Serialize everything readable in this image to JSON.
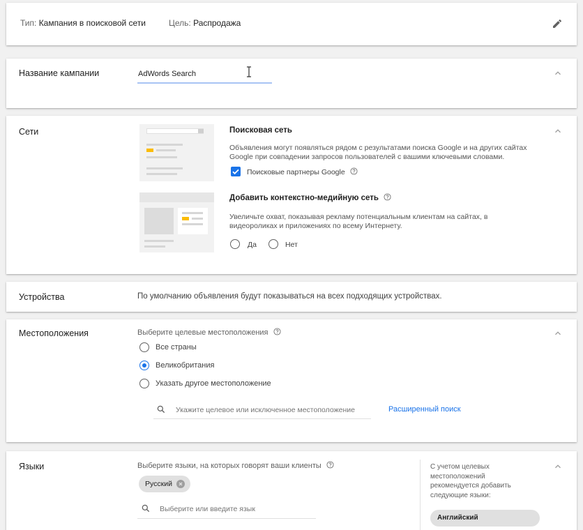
{
  "summary": {
    "type_prefix": "Тип:",
    "type_value": "Кампания в поисковой сети",
    "goal_prefix": "Цель:",
    "goal_value": "Распродажа"
  },
  "campaign_name": {
    "label": "Название кампании",
    "value": "AdWords Search"
  },
  "networks": {
    "label": "Сети",
    "search_title": "Поисковая сеть",
    "search_desc": "Объявления могут появляться рядом с результатами поиска Google и на других сайтах Google при совпадении запросов пользователей с вашими ключевыми словами.",
    "search_partners_label": "Поисковые партнеры Google",
    "search_partners_checked": true,
    "display_title": "Добавить контекстно-медийную сеть",
    "display_desc": "Увеличьте охват, показывая рекламу потенциальным клиентам на сайтах, в видеороликах и приложениях по всему Интернету.",
    "option_yes": "Да",
    "option_no": "Нет"
  },
  "devices": {
    "label": "Устройства",
    "text": "По умолчанию объявления будут показываться на всех подходящих устройствах."
  },
  "locations": {
    "label": "Местоположения",
    "prompt": "Выберите целевые местоположения",
    "options": [
      "Все страны",
      "Великобритания",
      "Указать другое местоположение"
    ],
    "selected": "Великобритания",
    "search_placeholder": "Укажите целевое или исключенное местоположение",
    "advanced_search": "Расширенный поиск"
  },
  "languages": {
    "label": "Языки",
    "prompt": "Выберите языки, на которых говорят ваши клиенты",
    "selected_chip": "Русский",
    "search_placeholder": "Выберите или введите язык",
    "recommendation": "С учетом целевых местоположений рекомендуется добавить следующие языки:",
    "recommended_chip": "Английский"
  },
  "colors": {
    "accent_blue": "#1a73e8",
    "link_blue": "#1a73e8",
    "highlight_yellow": "#fbbc04"
  },
  "icons": [
    "edit-pencil-icon",
    "chevron-up-icon",
    "help-icon",
    "search-icon",
    "chip-remove-icon",
    "checkbox-checked-icon",
    "text-cursor-icon"
  ]
}
